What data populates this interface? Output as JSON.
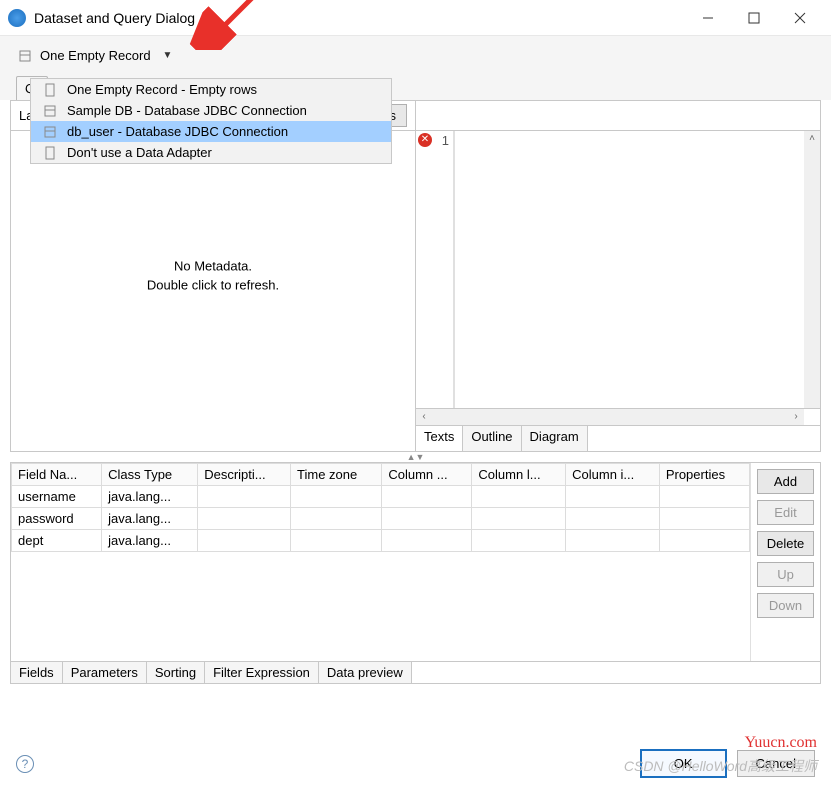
{
  "window": {
    "title": "Dataset and Query Dialog"
  },
  "adapter": {
    "selected": "One Empty Record",
    "options": [
      "One Empty Record - Empty rows",
      "Sample DB - Database JDBC Connection",
      "db_user - Database JDBC Connection",
      "Don't use a Data Adapter"
    ],
    "highlighted_index": 2
  },
  "top_tab": {
    "label": "Que"
  },
  "language_bar": {
    "label_prefix": "Lar",
    "read_fields": "Read Fields"
  },
  "metadata_hint": {
    "line1": "No Metadata.",
    "line2": "Double click to refresh."
  },
  "editor": {
    "line_number": "1"
  },
  "right_tabs": [
    "Texts",
    "Outline",
    "Diagram"
  ],
  "fields_table": {
    "headers": [
      "Field Na...",
      "Class Type",
      "Descripti...",
      "Time zone",
      "Column ...",
      "Column l...",
      "Column i...",
      "Properties"
    ],
    "rows": [
      {
        "name": "username",
        "class": "java.lang..."
      },
      {
        "name": "password",
        "class": "java.lang..."
      },
      {
        "name": "dept",
        "class": "java.lang..."
      }
    ]
  },
  "field_buttons": {
    "add": "Add",
    "edit": "Edit",
    "delete": "Delete",
    "up": "Up",
    "down": "Down"
  },
  "footer_tabs": [
    "Fields",
    "Parameters",
    "Sorting",
    "Filter Expression",
    "Data preview"
  ],
  "dialog_buttons": {
    "ok": "OK",
    "cancel": "Cancel"
  },
  "watermarks": {
    "site": "Yuucn.com",
    "author": "CSDN @HelloWord高级工程师"
  }
}
